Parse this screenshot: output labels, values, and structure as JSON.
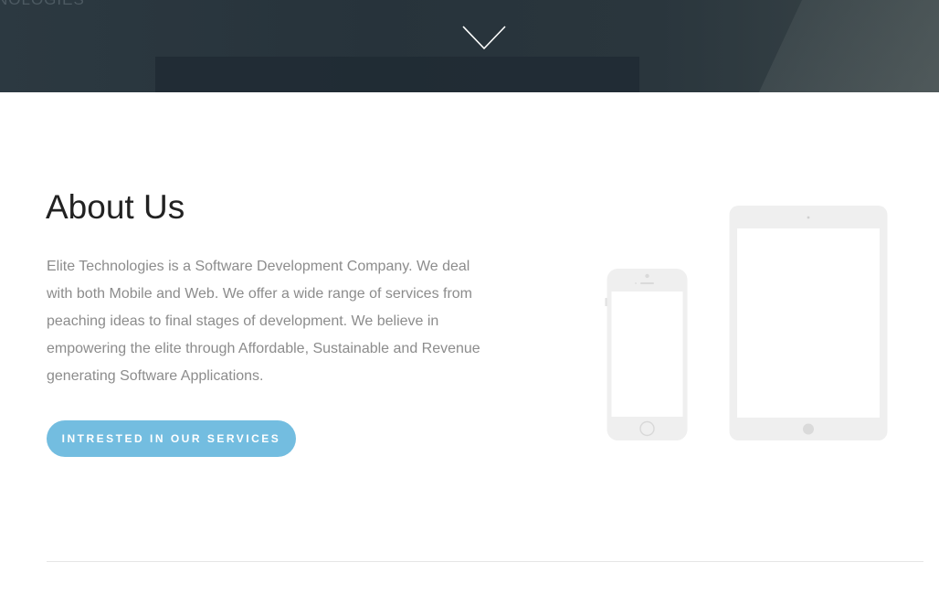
{
  "hero": {
    "title_fragment": "NOLOGIES",
    "scroll_icon": "chevron-down-icon"
  },
  "about": {
    "title": "About Us",
    "body": "Elite Technologies is a Software Development Company. We deal with both Mobile and Web. We offer a wide range of services from peaching ideas to final stages of development. We believe in empowering the elite through Affordable, Sustainable and Revenue generating Software Applications.",
    "cta_label": "INTRESTED IN OUR SERVICES"
  },
  "illustration": {
    "devices": [
      "phone",
      "tablet"
    ]
  },
  "colors": {
    "hero_background": "#2b373e",
    "accent_button": "#73bde0",
    "heading": "#222222",
    "body_text": "#8c8c8c",
    "device_gray": "#efefef"
  }
}
